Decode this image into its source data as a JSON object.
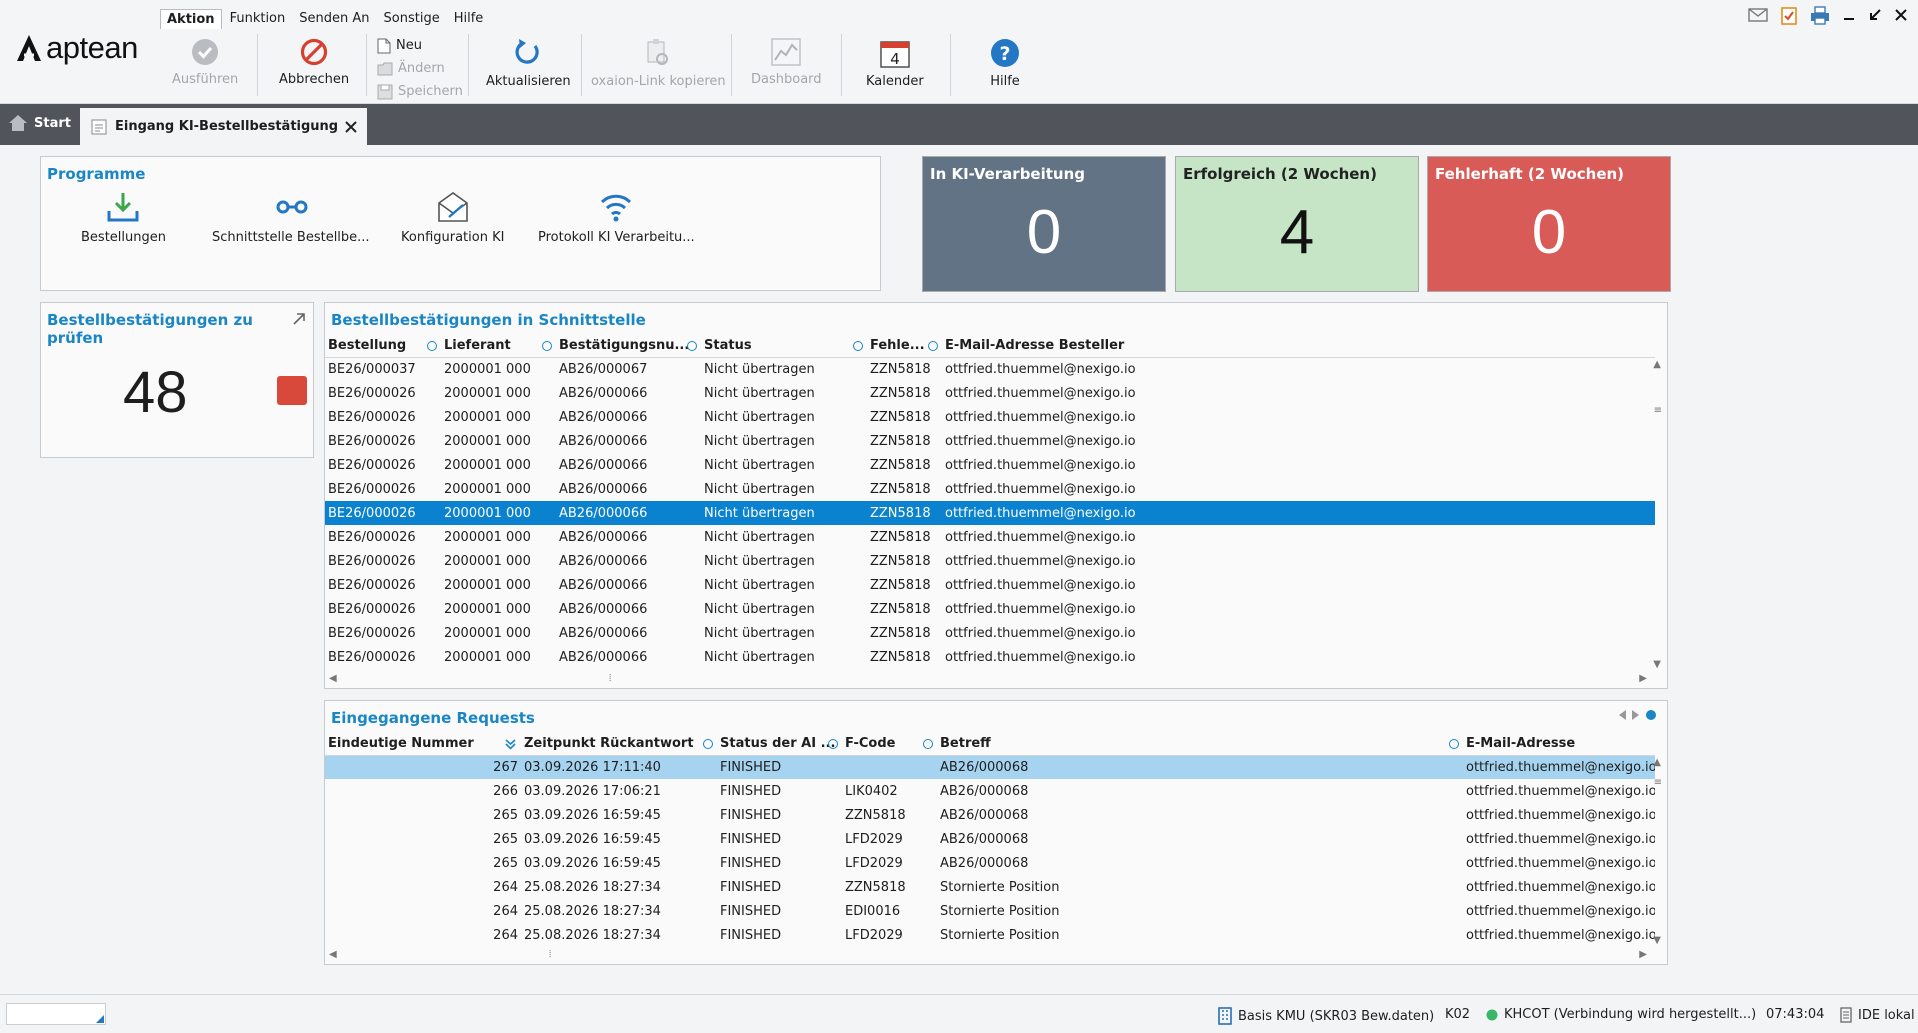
{
  "app": {
    "logo_text": "aptean"
  },
  "menu": [
    "Aktion",
    "Funktion",
    "Senden An",
    "Sonstige",
    "Hilfe"
  ],
  "ribbon": {
    "ausfuehren": "Ausführen",
    "abbrechen": "Abbrechen",
    "neu": "Neu",
    "aendern": "Ändern",
    "speichern": "Speichern",
    "aktualisieren": "Aktualisieren",
    "oxaion_link": "oxaion-Link kopieren",
    "dashboard": "Dashboard",
    "kalender": "Kalender",
    "kalender_day": "4",
    "hilfe": "Hilfe"
  },
  "tabs": {
    "start": "Start",
    "active": "Eingang KI-Bestellbestätigung"
  },
  "programme": {
    "title": "Programme",
    "items": [
      "Bestellungen",
      "Schnittstelle Bestellbe...",
      "Konfiguration KI",
      "Protokoll KI Verarbeitu..."
    ]
  },
  "tiles": [
    {
      "title": "In KI-Verarbeitung",
      "value": "0",
      "color": "#637386"
    },
    {
      "title": "Erfolgreich (2 Wochen)",
      "value": "4",
      "color": "#c5e5c6"
    },
    {
      "title": "Fehlerhaft (2 Wochen)",
      "value": "0",
      "color": "#d95b58"
    }
  ],
  "pruefen": {
    "title": "Bestellbestätigungen zu prüfen",
    "value": "48",
    "accent": "#d9493a"
  },
  "schnittstelle": {
    "title": "Bestellbestätigungen in Schnittstelle",
    "columns": [
      "Bestellung",
      "Lieferant",
      "Bestätigungsnu...",
      "Status",
      "Fehle...",
      "E-Mail-Adresse Besteller"
    ],
    "rows": [
      [
        "BE26/000037",
        "2000001 000",
        "AB26/000067",
        "Nicht übertragen",
        "ZZN5818",
        "ottfried.thuemmel@nexigo.io"
      ],
      [
        "BE26/000026",
        "2000001 000",
        "AB26/000066",
        "Nicht übertragen",
        "ZZN5818",
        "ottfried.thuemmel@nexigo.io"
      ],
      [
        "BE26/000026",
        "2000001 000",
        "AB26/000066",
        "Nicht übertragen",
        "ZZN5818",
        "ottfried.thuemmel@nexigo.io"
      ],
      [
        "BE26/000026",
        "2000001 000",
        "AB26/000066",
        "Nicht übertragen",
        "ZZN5818",
        "ottfried.thuemmel@nexigo.io"
      ],
      [
        "BE26/000026",
        "2000001 000",
        "AB26/000066",
        "Nicht übertragen",
        "ZZN5818",
        "ottfried.thuemmel@nexigo.io"
      ],
      [
        "BE26/000026",
        "2000001 000",
        "AB26/000066",
        "Nicht übertragen",
        "ZZN5818",
        "ottfried.thuemmel@nexigo.io"
      ],
      [
        "BE26/000026",
        "2000001 000",
        "AB26/000066",
        "Nicht übertragen",
        "ZZN5818",
        "ottfried.thuemmel@nexigo.io"
      ],
      [
        "BE26/000026",
        "2000001 000",
        "AB26/000066",
        "Nicht übertragen",
        "ZZN5818",
        "ottfried.thuemmel@nexigo.io"
      ],
      [
        "BE26/000026",
        "2000001 000",
        "AB26/000066",
        "Nicht übertragen",
        "ZZN5818",
        "ottfried.thuemmel@nexigo.io"
      ],
      [
        "BE26/000026",
        "2000001 000",
        "AB26/000066",
        "Nicht übertragen",
        "ZZN5818",
        "ottfried.thuemmel@nexigo.io"
      ],
      [
        "BE26/000026",
        "2000001 000",
        "AB26/000066",
        "Nicht übertragen",
        "ZZN5818",
        "ottfried.thuemmel@nexigo.io"
      ],
      [
        "BE26/000026",
        "2000001 000",
        "AB26/000066",
        "Nicht übertragen",
        "ZZN5818",
        "ottfried.thuemmel@nexigo.io"
      ],
      [
        "BE26/000026",
        "2000001 000",
        "AB26/000066",
        "Nicht übertragen",
        "ZZN5818",
        "ottfried.thuemmel@nexigo.io"
      ]
    ],
    "selected_row": 6
  },
  "requests": {
    "title": "Eingegangene Requests",
    "columns": [
      "Eindeutige Nummer",
      "Zeitpunkt Rückantwort",
      "Status der AI ...",
      "F-Code",
      "Betreff",
      "E-Mail-Adresse"
    ],
    "rows": [
      [
        "267",
        "03.09.2026 17:11:40",
        "FINISHED",
        "",
        "AB26/000068",
        "ottfried.thuemmel@nexigo.io"
      ],
      [
        "266",
        "03.09.2026 17:06:21",
        "FINISHED",
        "LIK0402",
        "AB26/000068",
        "ottfried.thuemmel@nexigo.io"
      ],
      [
        "265",
        "03.09.2026 16:59:45",
        "FINISHED",
        "ZZN5818",
        "AB26/000068",
        "ottfried.thuemmel@nexigo.io"
      ],
      [
        "265",
        "03.09.2026 16:59:45",
        "FINISHED",
        "LFD2029",
        "AB26/000068",
        "ottfried.thuemmel@nexigo.io"
      ],
      [
        "265",
        "03.09.2026 16:59:45",
        "FINISHED",
        "LFD2029",
        "AB26/000068",
        "ottfried.thuemmel@nexigo.io"
      ],
      [
        "264",
        "25.08.2026 18:27:34",
        "FINISHED",
        "ZZN5818",
        "Stornierte Position",
        "ottfried.thuemmel@nexigo.io"
      ],
      [
        "264",
        "25.08.2026 18:27:34",
        "FINISHED",
        "EDI0016",
        "Stornierte Position",
        "ottfried.thuemmel@nexigo.io"
      ],
      [
        "264",
        "25.08.2026 18:27:34",
        "FINISHED",
        "LFD2029",
        "Stornierte Position",
        "ottfried.thuemmel@nexigo.io"
      ]
    ],
    "selected_row": 0
  },
  "statusbar": {
    "basis": "Basis KMU (SKR03 Bew.daten)",
    "company": "K02",
    "connection": "KHCOT (Verbindung wird hergestellt...)",
    "time": "07:43:04",
    "ide": "IDE lokal"
  },
  "colors": {
    "accent": "#1a86c5",
    "selection": "#0a82cf",
    "selection_light": "#a6d4f0"
  }
}
